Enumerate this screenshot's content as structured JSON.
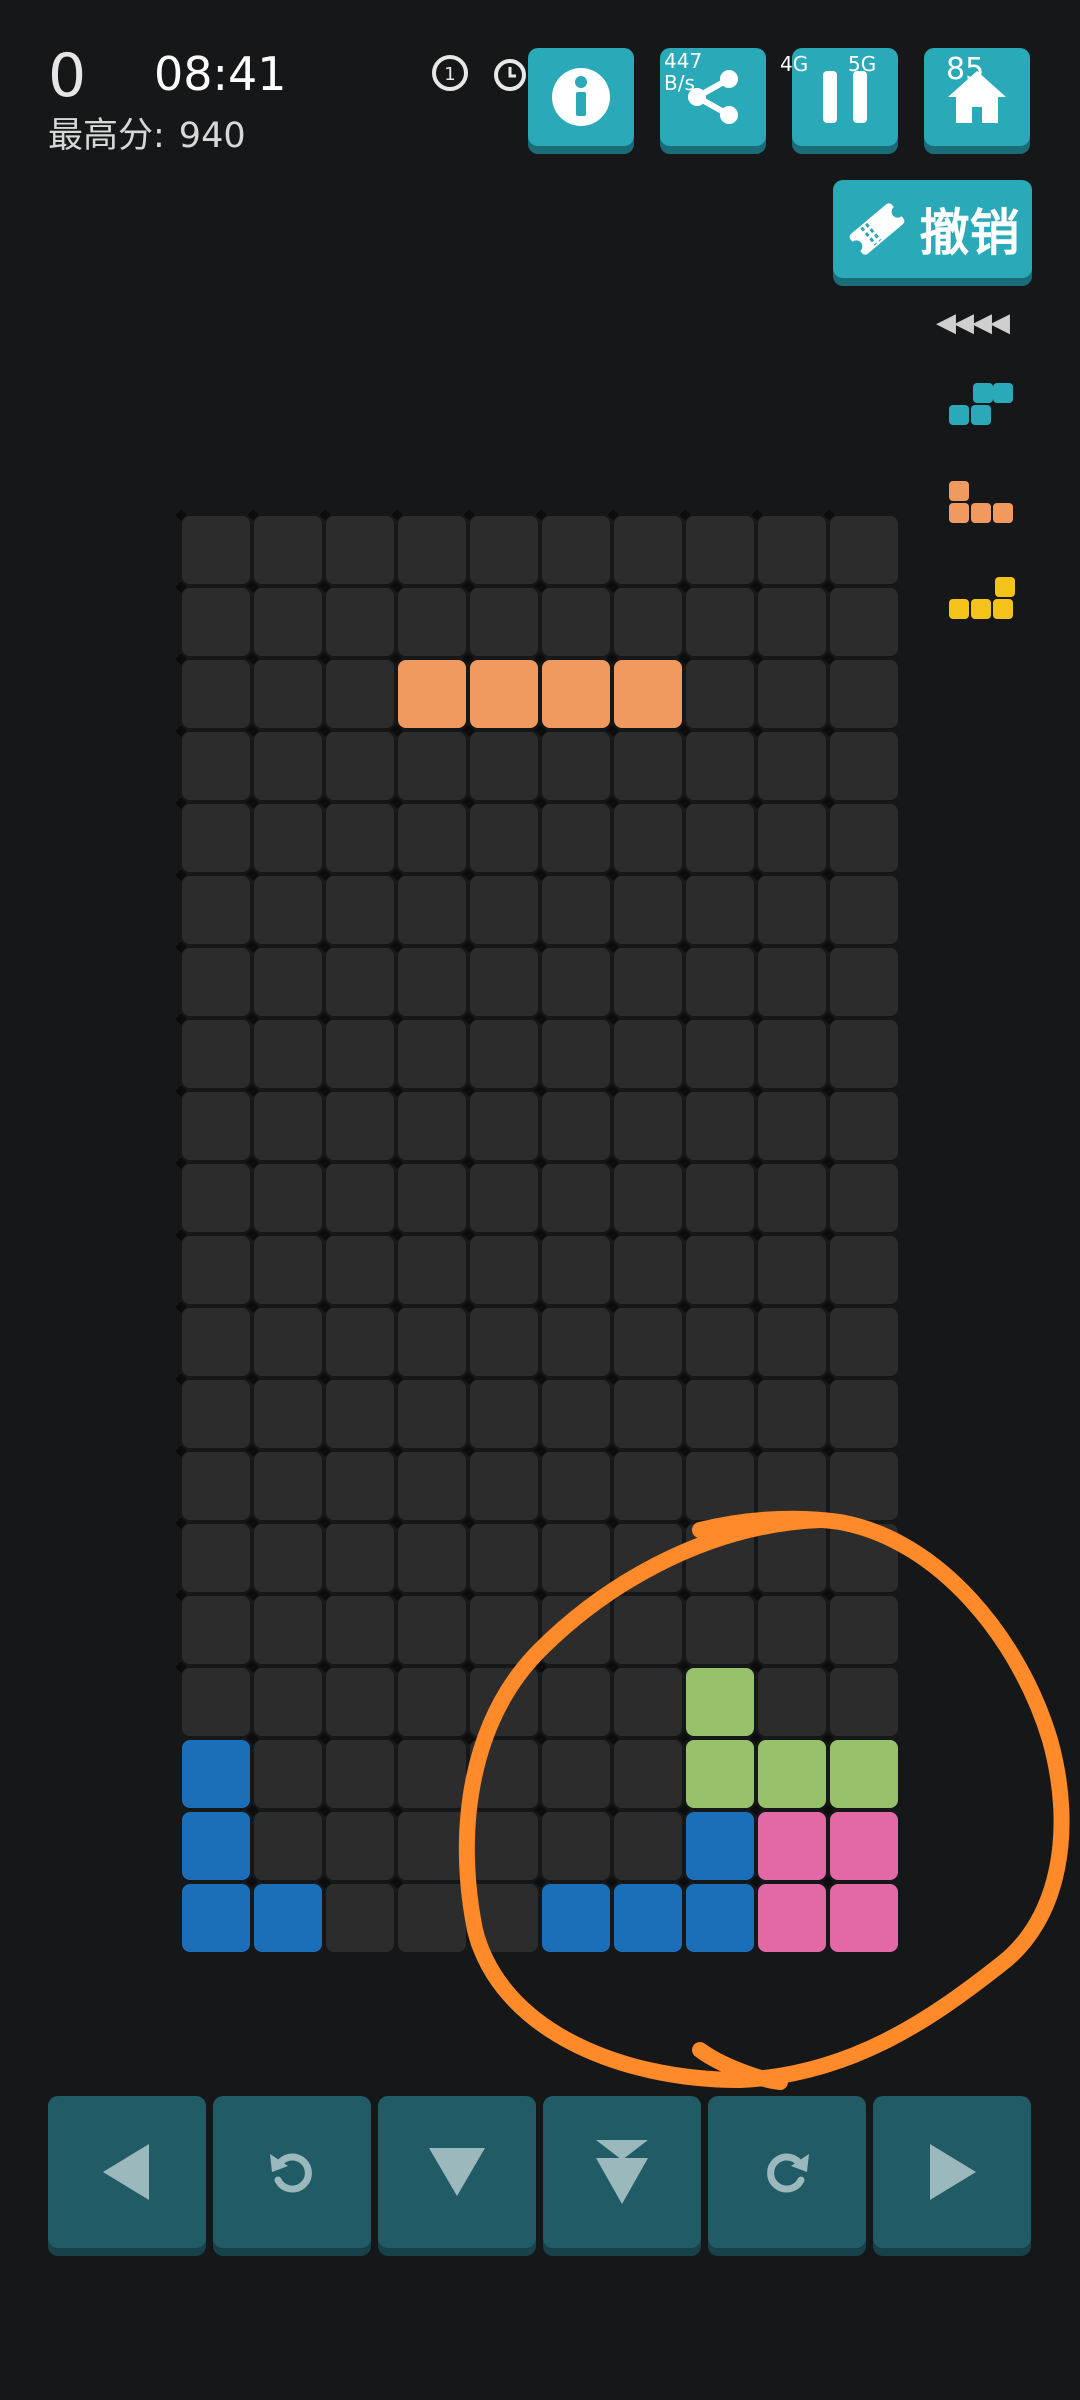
{
  "game": {
    "score": "0",
    "best_label": "最高分:",
    "best_value": "940",
    "undo_label": "撤销",
    "next_indicator": "◀◀◀◀"
  },
  "status_bar": {
    "time": "08:41",
    "net_speed": "447 B/s",
    "sim1": "4G",
    "sim2": "5G",
    "battery": "85"
  },
  "colors": {
    "orange": "#f09a5f",
    "blue": "#1b6fb8",
    "green": "#97c16b",
    "pink": "#e268a6",
    "teal": "#2aa9b8",
    "yellow": "#f4c31a",
    "annotation": "#ff8a2a"
  },
  "board": {
    "columns": 10,
    "rows": 20,
    "cells": [
      {
        "row": 2,
        "col": 3,
        "color": "orange"
      },
      {
        "row": 2,
        "col": 4,
        "color": "orange"
      },
      {
        "row": 2,
        "col": 5,
        "color": "orange"
      },
      {
        "row": 2,
        "col": 6,
        "color": "orange"
      },
      {
        "row": 16,
        "col": 7,
        "color": "green"
      },
      {
        "row": 17,
        "col": 0,
        "color": "blue"
      },
      {
        "row": 17,
        "col": 7,
        "color": "green"
      },
      {
        "row": 17,
        "col": 8,
        "color": "green"
      },
      {
        "row": 17,
        "col": 9,
        "color": "green"
      },
      {
        "row": 18,
        "col": 0,
        "color": "blue"
      },
      {
        "row": 18,
        "col": 7,
        "color": "blue"
      },
      {
        "row": 18,
        "col": 8,
        "color": "pink"
      },
      {
        "row": 18,
        "col": 9,
        "color": "pink"
      },
      {
        "row": 19,
        "col": 0,
        "color": "blue"
      },
      {
        "row": 19,
        "col": 1,
        "color": "blue"
      },
      {
        "row": 19,
        "col": 5,
        "color": "blue"
      },
      {
        "row": 19,
        "col": 6,
        "color": "blue"
      },
      {
        "row": 19,
        "col": 7,
        "color": "blue"
      },
      {
        "row": 19,
        "col": 8,
        "color": "pink"
      },
      {
        "row": 19,
        "col": 9,
        "color": "pink"
      }
    ]
  },
  "next_pieces": [
    {
      "color": "teal",
      "shape": "S"
    },
    {
      "color": "orange",
      "shape": "J"
    },
    {
      "color": "yellow",
      "shape": "L"
    }
  ],
  "top_buttons": [
    {
      "name": "info-button",
      "icon": "info-icon"
    },
    {
      "name": "share-button",
      "icon": "share-icon"
    },
    {
      "name": "pause-button",
      "icon": "pause-icon"
    },
    {
      "name": "home-button",
      "icon": "home-icon"
    }
  ],
  "controls": [
    {
      "name": "move-left-button",
      "icon": "triangle-left-icon"
    },
    {
      "name": "rotate-left-button",
      "icon": "rotate-ccw-icon"
    },
    {
      "name": "soft-drop-button",
      "icon": "triangle-down-icon"
    },
    {
      "name": "hard-drop-button",
      "icon": "double-down-icon"
    },
    {
      "name": "rotate-right-button",
      "icon": "rotate-cw-icon"
    },
    {
      "name": "move-right-button",
      "icon": "triangle-right-icon"
    }
  ]
}
